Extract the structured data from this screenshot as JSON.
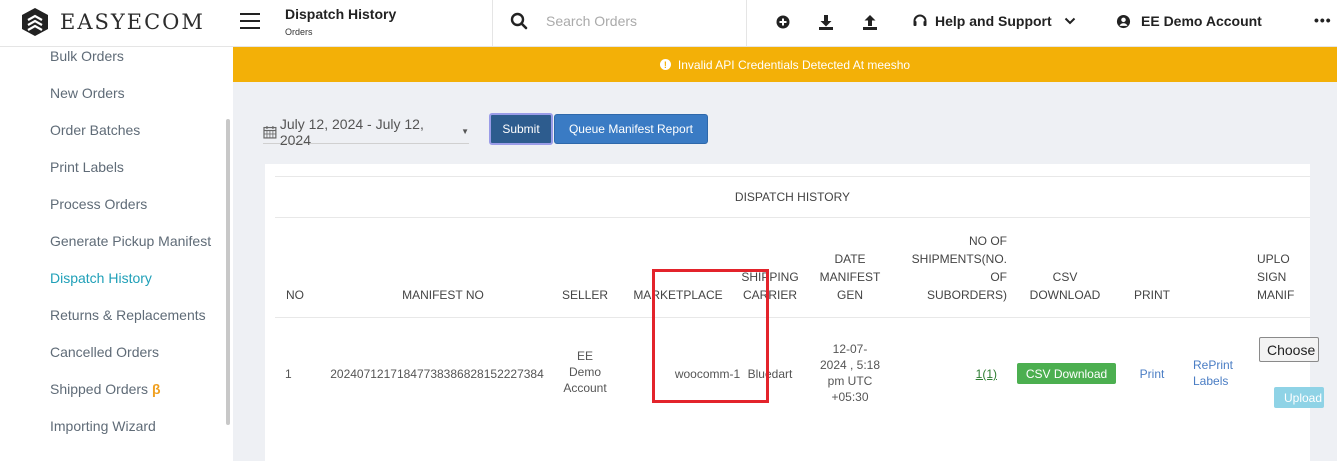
{
  "app": {
    "logo_text": "EASYECOM"
  },
  "header": {
    "title": "Dispatch History",
    "subtitle": "Orders",
    "search_placeholder": "Search Orders",
    "help_label": "Help and Support",
    "account_label": "EE Demo Account",
    "more_label": "•••"
  },
  "sidebar": {
    "items": [
      {
        "label": "Bulk Orders"
      },
      {
        "label": "New Orders"
      },
      {
        "label": "Order Batches"
      },
      {
        "label": "Print Labels"
      },
      {
        "label": "Process Orders"
      },
      {
        "label": "Generate Pickup Manifest"
      },
      {
        "label": "Dispatch History"
      },
      {
        "label": "Returns & Replacements"
      },
      {
        "label": "Cancelled Orders"
      },
      {
        "label": "Shipped Orders",
        "badge": "β"
      },
      {
        "label": "Importing Wizard"
      }
    ]
  },
  "alert": {
    "text": "Invalid API Credentials Detected At meesho"
  },
  "toolbar": {
    "date_range": "July 12, 2024 - July 12, 2024",
    "submit_label": "Submit",
    "queue_label": "Queue Manifest Report"
  },
  "table": {
    "title": "DISPATCH HISTORY",
    "headers": {
      "no": "NO",
      "manifest_no": "MANIFEST NO",
      "seller": "SELLER",
      "marketplace": "MARKETPLACE",
      "carrier_1": "SHIPPING",
      "carrier_2": "CARRIER",
      "date_1": "DATE",
      "date_2": "MANIFEST",
      "date_3": "GEN",
      "ship_1": "NO OF",
      "ship_2": "SHIPMENTS(NO.",
      "ship_3": "OF",
      "ship_4": "SUBORDERS)",
      "csv_1": "CSV",
      "csv_2": "DOWNLOAD",
      "print": "PRINT",
      "upload_1": "UPLO",
      "upload_2": "SIGN",
      "upload_3": "MANIF"
    },
    "rows": [
      {
        "no": "1",
        "manifest_no": "20240712171847738386828152227384",
        "seller_1": "EE",
        "seller_2": "Demo",
        "seller_3": "Account",
        "marketplace": "woocomm-1",
        "carrier": "Bluedart",
        "date_1": "12-07-",
        "date_2": "2024 , 5:18",
        "date_3": "pm UTC",
        "date_4": "+05:30",
        "shipments": "1(1)",
        "csv_button": "CSV Download",
        "print_link": "Print",
        "reprint_1": "RePrint",
        "reprint_2": "Labels",
        "choose_label": "Choose",
        "upload_label": "Upload"
      }
    ]
  },
  "colors": {
    "alert_bg": "#f3b007",
    "active_nav": "#20a0b8",
    "submit_bg": "#2d5c8e",
    "queue_bg": "#3a7bc4",
    "csv_bg": "#4caf50",
    "highlight_border": "#e3232b"
  }
}
